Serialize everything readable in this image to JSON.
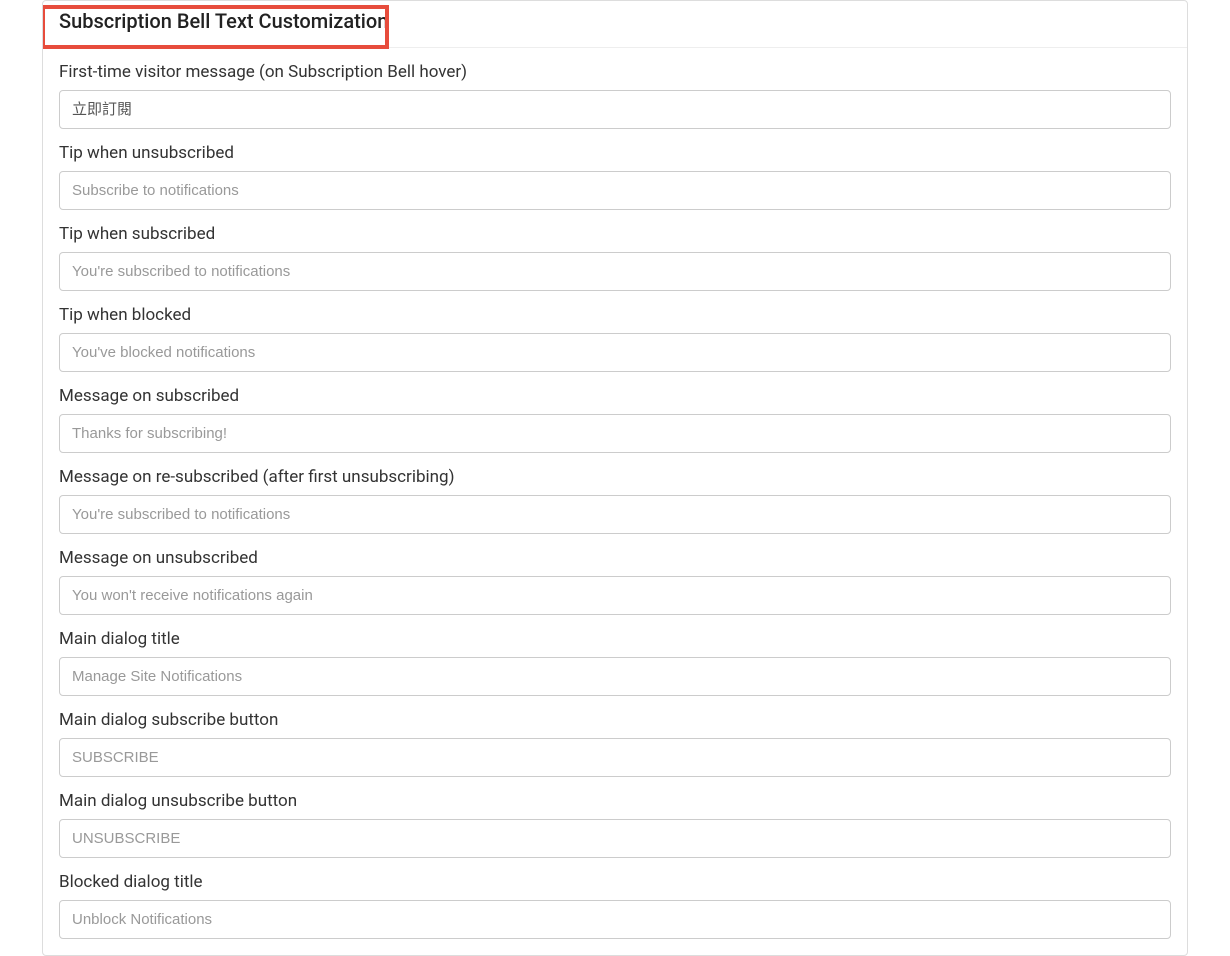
{
  "section": {
    "title": "Subscription Bell Text Customization"
  },
  "fields": {
    "first_time": {
      "label": "First-time visitor message (on Subscription Bell hover)",
      "value": "立即訂閱"
    },
    "tip_unsubscribed": {
      "label": "Tip when unsubscribed",
      "placeholder": "Subscribe to notifications"
    },
    "tip_subscribed": {
      "label": "Tip when subscribed",
      "placeholder": "You're subscribed to notifications"
    },
    "tip_blocked": {
      "label": "Tip when blocked",
      "placeholder": "You've blocked notifications"
    },
    "msg_subscribed": {
      "label": "Message on subscribed",
      "placeholder": "Thanks for subscribing!"
    },
    "msg_resubscribed": {
      "label": "Message on re-subscribed (after first unsubscribing)",
      "placeholder": "You're subscribed to notifications"
    },
    "msg_unsubscribed": {
      "label": "Message on unsubscribed",
      "placeholder": "You won't receive notifications again"
    },
    "dialog_title": {
      "label": "Main dialog title",
      "placeholder": "Manage Site Notifications"
    },
    "dialog_subscribe": {
      "label": "Main dialog subscribe button",
      "placeholder": "SUBSCRIBE"
    },
    "dialog_unsubscribe": {
      "label": "Main dialog unsubscribe button",
      "placeholder": "UNSUBSCRIBE"
    },
    "blocked_title": {
      "label": "Blocked dialog title",
      "placeholder": "Unblock Notifications"
    }
  }
}
